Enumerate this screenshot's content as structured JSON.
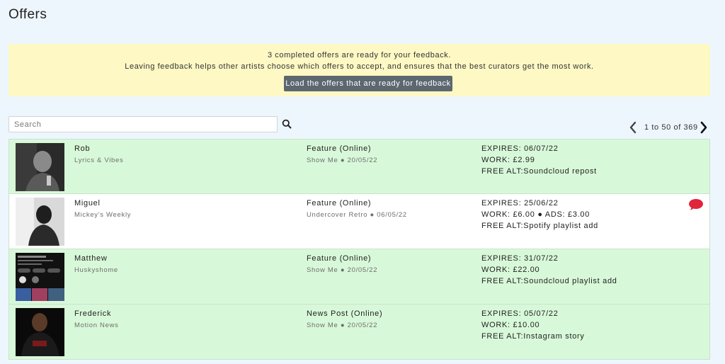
{
  "page": {
    "title": "Offers"
  },
  "banner": {
    "line1": "3 completed offers are ready for your feedback.",
    "line2": "Leaving feedback helps other artists choose which offers to accept, and ensures that the best curators get the most work.",
    "button_label": "Load the offers that are ready for feedback"
  },
  "search": {
    "placeholder": "Search",
    "value": "",
    "icon": "search-icon"
  },
  "pagination": {
    "range": "1 to 50 of 369",
    "prev_icon": "chevron-left-icon",
    "next_icon": "chevron-right-icon"
  },
  "colors": {
    "row_green": "#d8f9d9",
    "row_white": "#ffffff",
    "banner_bg": "#fdf8c4",
    "button_bg": "#5c6770",
    "chat_icon": "#e0243c"
  },
  "offers": [
    {
      "name": "Rob",
      "curator": "Lyrics & Vibes",
      "type": "Feature (Online)",
      "sub": "Show Me ● 20/05/22",
      "expires": "EXPIRES: 06/07/22",
      "work": "WORK: £2.99",
      "alt": "FREE ALT:Soundcloud repost",
      "status": "green"
    },
    {
      "name": "Miguel",
      "curator": "Mickey's Weekly",
      "type": "Feature (Online)",
      "sub": "Undercover Retro ● 06/05/22",
      "expires": "EXPIRES: 25/06/22",
      "work": "WORK: £6.00 ● ADS: £3.00",
      "alt": "FREE ALT:Spotify playlist add",
      "status": "white",
      "has_message": true
    },
    {
      "name": "Matthew",
      "curator": "Huskyshome",
      "type": "Feature (Online)",
      "sub": "Show Me ● 20/05/22",
      "expires": "EXPIRES: 31/07/22",
      "work": "WORK: £22.00",
      "alt": "FREE ALT:Soundcloud playlist add",
      "status": "green"
    },
    {
      "name": "Frederick",
      "curator": "Motion News",
      "type": "News Post (Online)",
      "sub": "Show Me ● 20/05/22",
      "expires": "EXPIRES: 05/07/22",
      "work": "WORK: £10.00",
      "alt": "FREE ALT:Instagram story",
      "status": "green"
    }
  ]
}
